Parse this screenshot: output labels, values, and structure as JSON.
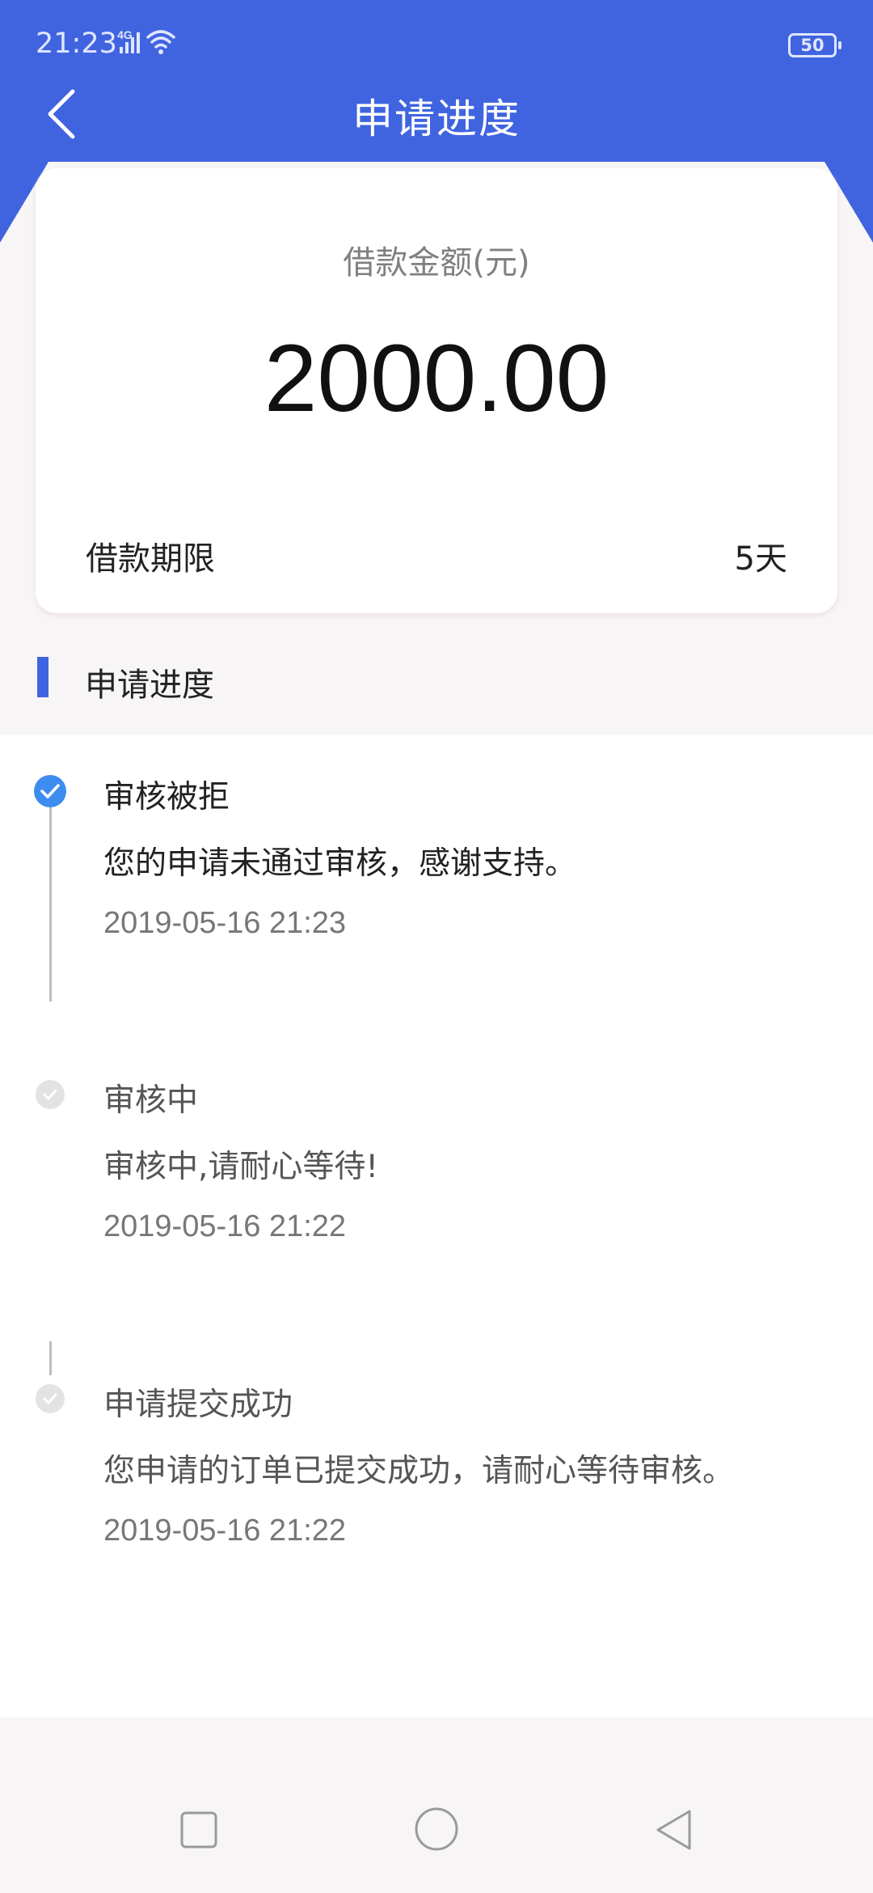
{
  "status_bar": {
    "time": "21:23",
    "network": "4G",
    "battery": "50"
  },
  "header": {
    "title": "申请进度",
    "back_icon": "chevron-left-icon",
    "color": "#4064e0"
  },
  "loan": {
    "amount_label": "借款金额(元)",
    "amount": "2000.00",
    "term_label": "借款期限",
    "term_value": "5天"
  },
  "progress_section": {
    "title": "申请进度"
  },
  "timeline": [
    {
      "title": "审核被拒",
      "desc": "您的申请未通过审核，感谢支持。",
      "time": "2019-05-16 21:23",
      "active": true
    },
    {
      "title": "审核中",
      "desc": "审核中,请耐心等待!",
      "time": "2019-05-16 21:22",
      "active": false
    },
    {
      "title": "申请提交成功",
      "desc": "您申请的订单已提交成功，请耐心等待审核。",
      "time": "2019-05-16 21:22",
      "active": false
    }
  ],
  "nav": {
    "recent_icon": "square-icon",
    "home_icon": "circle-icon",
    "back_icon": "triangle-back-icon"
  }
}
